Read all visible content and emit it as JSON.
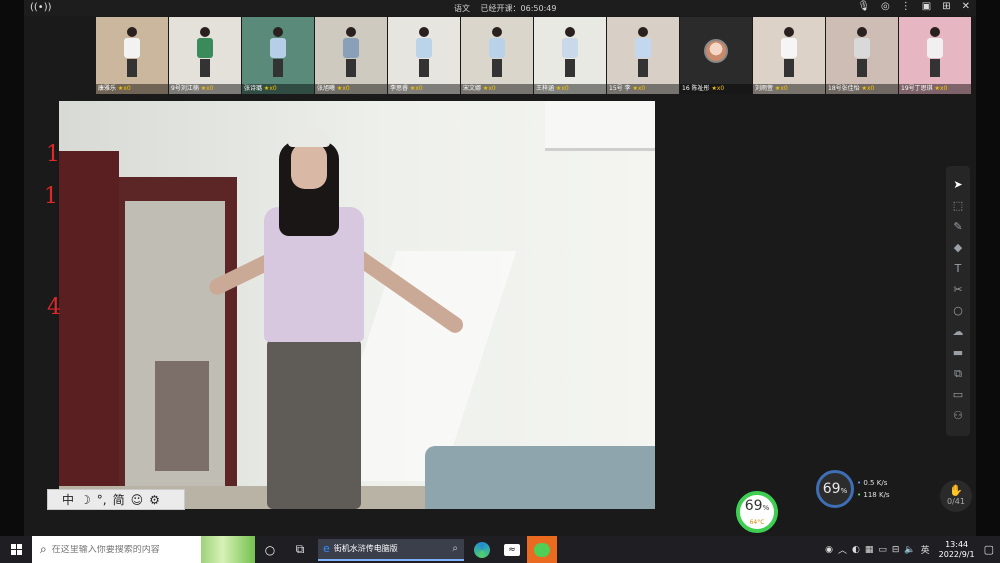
{
  "titlebar": {
    "subject": "语文",
    "elapsed_label": "已经开课：06:50:49"
  },
  "thumbnails": [
    {
      "name": "康雅乐",
      "stars": "x0",
      "shirt": "#f2f2f2",
      "bg": "#cbb79d"
    },
    {
      "name": "9号刘江楠",
      "stars": "x0",
      "shirt": "#3b8a5a",
      "bg": "#e3e1da"
    },
    {
      "name": "张诗璐",
      "stars": "x0",
      "shirt": "#b6cfe6",
      "bg": "#5a8a7a"
    },
    {
      "name": "张旭曦",
      "stars": "x0",
      "shirt": "#8aa0b8",
      "bg": "#cfcac0"
    },
    {
      "name": "李思睿",
      "stars": "x0",
      "shirt": "#bcd4ea",
      "bg": "#e7e5e0"
    },
    {
      "name": "宋文娜",
      "stars": "x0",
      "shirt": "#b9d2ea",
      "bg": "#dbd6cc"
    },
    {
      "name": "王梓涵",
      "stars": "x0",
      "shirt": "#c9d9ea",
      "bg": "#e9e9e3"
    },
    {
      "name": "15号 李",
      "stars": "x0",
      "shirt": "#c3d8ee",
      "bg": "#d8cfc6"
    },
    {
      "name": "16 陈祉彤",
      "stars": "x0",
      "shirt": "",
      "bg": "",
      "avatar": true
    },
    {
      "name": "刘雨萱",
      "stars": "x0",
      "shirt": "#f5f5f5",
      "bg": "#ddd2c8"
    },
    {
      "name": "18号张佳怡",
      "stars": "x0",
      "shirt": "#d9d9d9",
      "bg": "#cdbdb5"
    },
    {
      "name": "19号丁思琪",
      "stars": "x0",
      "shirt": "#f0f0f0",
      "bg": "#e6b7c2"
    }
  ],
  "ime": {
    "chinese": "中",
    "moon": "☽",
    "punct": "°,",
    "simplified": "简",
    "emoji": "☺",
    "settings": "⚙"
  },
  "annotations": [
    "1",
    "1",
    "4"
  ],
  "toolbar_icons": [
    "cursor-icon",
    "select-icon",
    "highlighter-icon",
    "eraser-icon",
    "text-icon",
    "scissors-icon",
    "shape-icon",
    "cloud-icon",
    "toolbox-icon",
    "screenshot-icon",
    "record-icon",
    "users-icon"
  ],
  "toolbar_glyphs": [
    "➤",
    "⬚",
    "✎",
    "◆",
    "T",
    "✂",
    "○",
    "☁",
    "▬",
    "⧉",
    "▭",
    "⚇"
  ],
  "network": {
    "gauge_value": "69",
    "gauge_unit": "%",
    "upload": "0.5",
    "upload_unit": "K/s",
    "download": "118",
    "download_unit": "K/s"
  },
  "cpu": {
    "value": "69",
    "unit": "%",
    "temp": "64°C"
  },
  "hand_raise": {
    "count": "0/41"
  },
  "taskbar": {
    "search_placeholder": "在这里输入你要搜索的内容",
    "active_app_label": "街机水浒传电脑版",
    "ime_lang": "英",
    "time": "13:44",
    "date": "2022/9/1"
  },
  "colors": {
    "accent_blue": "#3e6fb6",
    "cpu_green": "#3ecf52",
    "annotation_red": "#e02828",
    "star_gold": "#f0c400"
  }
}
